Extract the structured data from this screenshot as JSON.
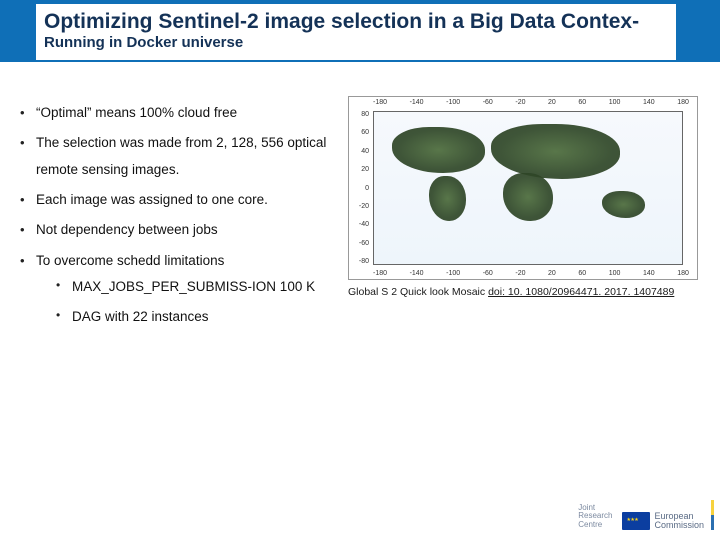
{
  "title": {
    "main": "Optimizing Sentinel-2 image selection in a Big Data Contex- ",
    "sub": "Running in Docker universe"
  },
  "bullets": [
    "“Optimal” means 100% cloud free",
    "The selection was made from 2, 128, 556 optical remote sensing images.",
    "Each image was assigned to one core.",
    "Not dependency between jobs",
    "To overcome schedd limitations"
  ],
  "sub_bullets": [
    "MAX_JOBS_PER_SUBMISS-ION  100 K",
    "DAG with 22 instances"
  ],
  "map": {
    "lon_ticks": [
      "-180",
      "-140",
      "-100",
      "-60",
      "-20",
      "20",
      "60",
      "100",
      "140",
      "180"
    ],
    "lat_ticks": [
      "80",
      "60",
      "40",
      "20",
      "0",
      "-20",
      "-40",
      "-60",
      "-80"
    ]
  },
  "caption": {
    "text": "Global S 2 Quick look Mosaic ",
    "doi": "doi: 10. 1080/20964471. 2017. 1407489"
  },
  "footer": {
    "jrc": "Joint\nResearch\nCentre",
    "ec1": "European",
    "ec2": "Commission"
  }
}
